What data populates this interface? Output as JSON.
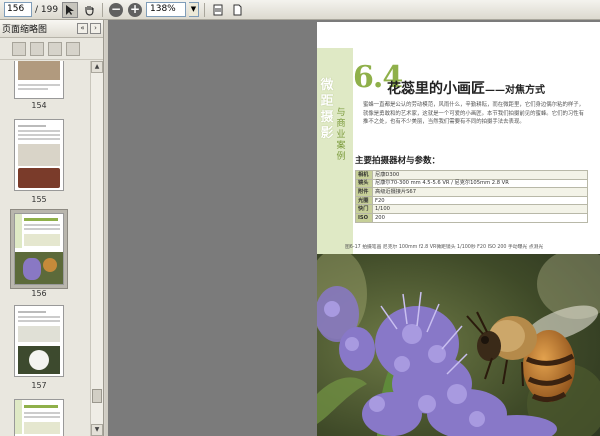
{
  "toolbar": {
    "page_current": "156",
    "page_total": "/ 199",
    "zoom": "138%"
  },
  "sidebar": {
    "title": "页面缩略图",
    "thumbnails": [
      {
        "label": "154"
      },
      {
        "label": "155"
      },
      {
        "label": "156"
      },
      {
        "label": "157"
      }
    ]
  },
  "document": {
    "vertical_big": "微距摄影",
    "vertical_small": "与商业案例",
    "chapter_number": "6.4",
    "chapter_title": "花蕊里的小画匠",
    "chapter_subtitle": "——对焦方式",
    "body_text": "蜜蜂一直都是公认的劳动模范，风雨什么，辛勤耕耘，而在微距里，它们身边偶尔粘的样子，就像是勇敢和的艺术家，这就是一个可爱的小画匠。本节我们拍摄前见的蜜蜂。它们的习性有推不之处，也有不少美丽，当然我们需要有不同的拍摄手法去表现。",
    "section_heading": "主要拍摄器材与参数：",
    "spec_rows": [
      {
        "key": "相机",
        "value": "尼康D300"
      },
      {
        "key": "镜头",
        "value": "尼康尔70-300 mm 4.5-5.6 VR / 尼克尔105mm 2.8 VR"
      },
      {
        "key": "附件",
        "value": "高级近摄接片S67"
      },
      {
        "key": "光圈",
        "value": "F20"
      },
      {
        "key": "快门",
        "value": "1/100"
      },
      {
        "key": "ISO",
        "value": "200"
      }
    ],
    "caption": "图6-17  拍摄笔画  尼克尔 100mm f2.8 VR微距镜头    1/100秒  F20  ISO 200  手动曝光    点测光"
  },
  "colors": {
    "accent_green": "#8fb04a",
    "band_green": "#dfe9c5",
    "table_key_bg": "#c6cf98",
    "viewer_bg": "#7b7b7b"
  }
}
